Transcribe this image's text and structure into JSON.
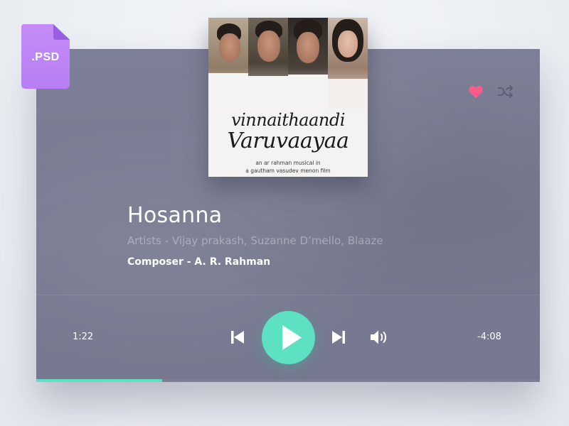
{
  "badge": {
    "label": ".PSD"
  },
  "album": {
    "title_line_1": "vinnaithaandi",
    "title_line_2": "Varuvaayaa",
    "credit_line_1": "an ar rahman musical in",
    "credit_line_2": "a gautham vasudev menon film"
  },
  "track": {
    "title": "Hosanna",
    "artists": "Artists - Vijay prakash, Suzanne D’mello, Blaaze",
    "composer": "Composer - A. R. Rahman"
  },
  "playback": {
    "elapsed": "1:22",
    "remaining": "-4:08",
    "progress": 0.25,
    "state": "paused"
  },
  "controls": {
    "favorite": {
      "icon": "heart-icon",
      "active": true,
      "color": "#ff5a8a"
    },
    "shuffle": {
      "icon": "shuffle-icon"
    },
    "previous": {
      "icon": "skip-previous-icon"
    },
    "play": {
      "icon": "play-icon"
    },
    "next": {
      "icon": "skip-next-icon"
    },
    "volume": {
      "icon": "volume-icon"
    }
  },
  "colors": {
    "accent": "#5ee0c2",
    "badge": "#b77ef3",
    "panel": "#7b7d94"
  }
}
